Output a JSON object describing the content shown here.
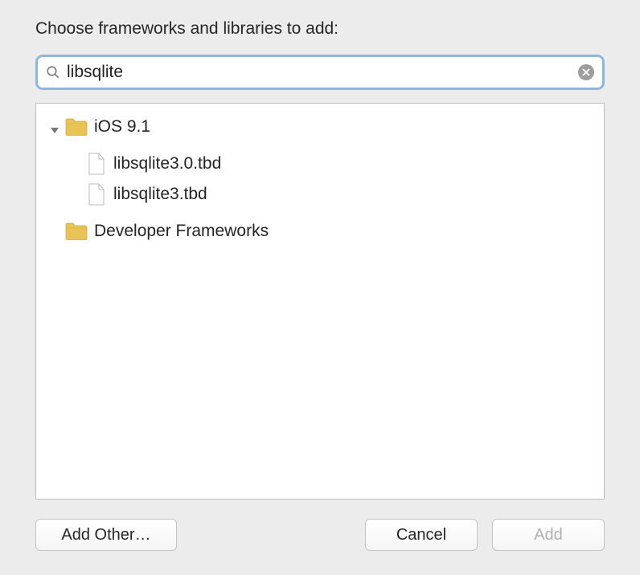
{
  "dialog": {
    "title": "Choose frameworks and libraries to add:"
  },
  "search": {
    "value": "libsqlite",
    "placeholder": ""
  },
  "tree": {
    "group_label": "iOS 9.1",
    "items": [
      {
        "label": "libsqlite3.0.tbd"
      },
      {
        "label": "libsqlite3.tbd"
      }
    ],
    "dev_frameworks_label": "Developer Frameworks"
  },
  "buttons": {
    "add_other": "Add Other…",
    "cancel": "Cancel",
    "add": "Add"
  }
}
